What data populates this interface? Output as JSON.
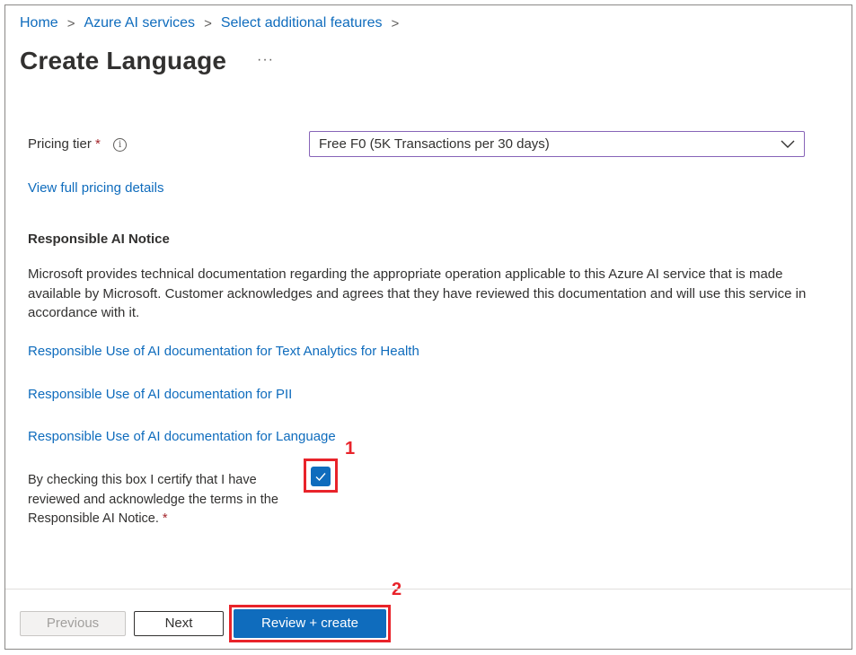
{
  "breadcrumb": {
    "items": [
      "Home",
      "Azure AI services",
      "Select additional features"
    ],
    "separator": ">"
  },
  "page": {
    "title": "Create Language",
    "more": "···"
  },
  "pricing": {
    "label": "Pricing tier",
    "required_mark": "*",
    "info": "i",
    "selected": "Free F0 (5K Transactions per 30 days)",
    "view_link": "View full pricing details"
  },
  "notice": {
    "heading": "Responsible AI Notice",
    "body": "Microsoft provides technical documentation regarding the appropriate operation applicable to this Azure AI service that is made available by Microsoft. Customer acknowledges and agrees that they have reviewed this documentation and will use this service in accordance with it.",
    "links": [
      "Responsible Use of AI documentation for Text Analytics for Health",
      "Responsible Use of AI documentation for PII",
      "Responsible Use of AI documentation for Language"
    ],
    "certify_text": "By checking this box I certify that I have reviewed and acknowledge the terms in the Responsible AI Notice.",
    "certify_required": "*",
    "checked": true
  },
  "annotations": {
    "step1": "1",
    "step2": "2",
    "color": "#e8232a"
  },
  "footer": {
    "previous": "Previous",
    "next": "Next",
    "review": "Review + create"
  },
  "colors": {
    "accent": "#0f6cbd",
    "select_border": "#8764b8"
  }
}
